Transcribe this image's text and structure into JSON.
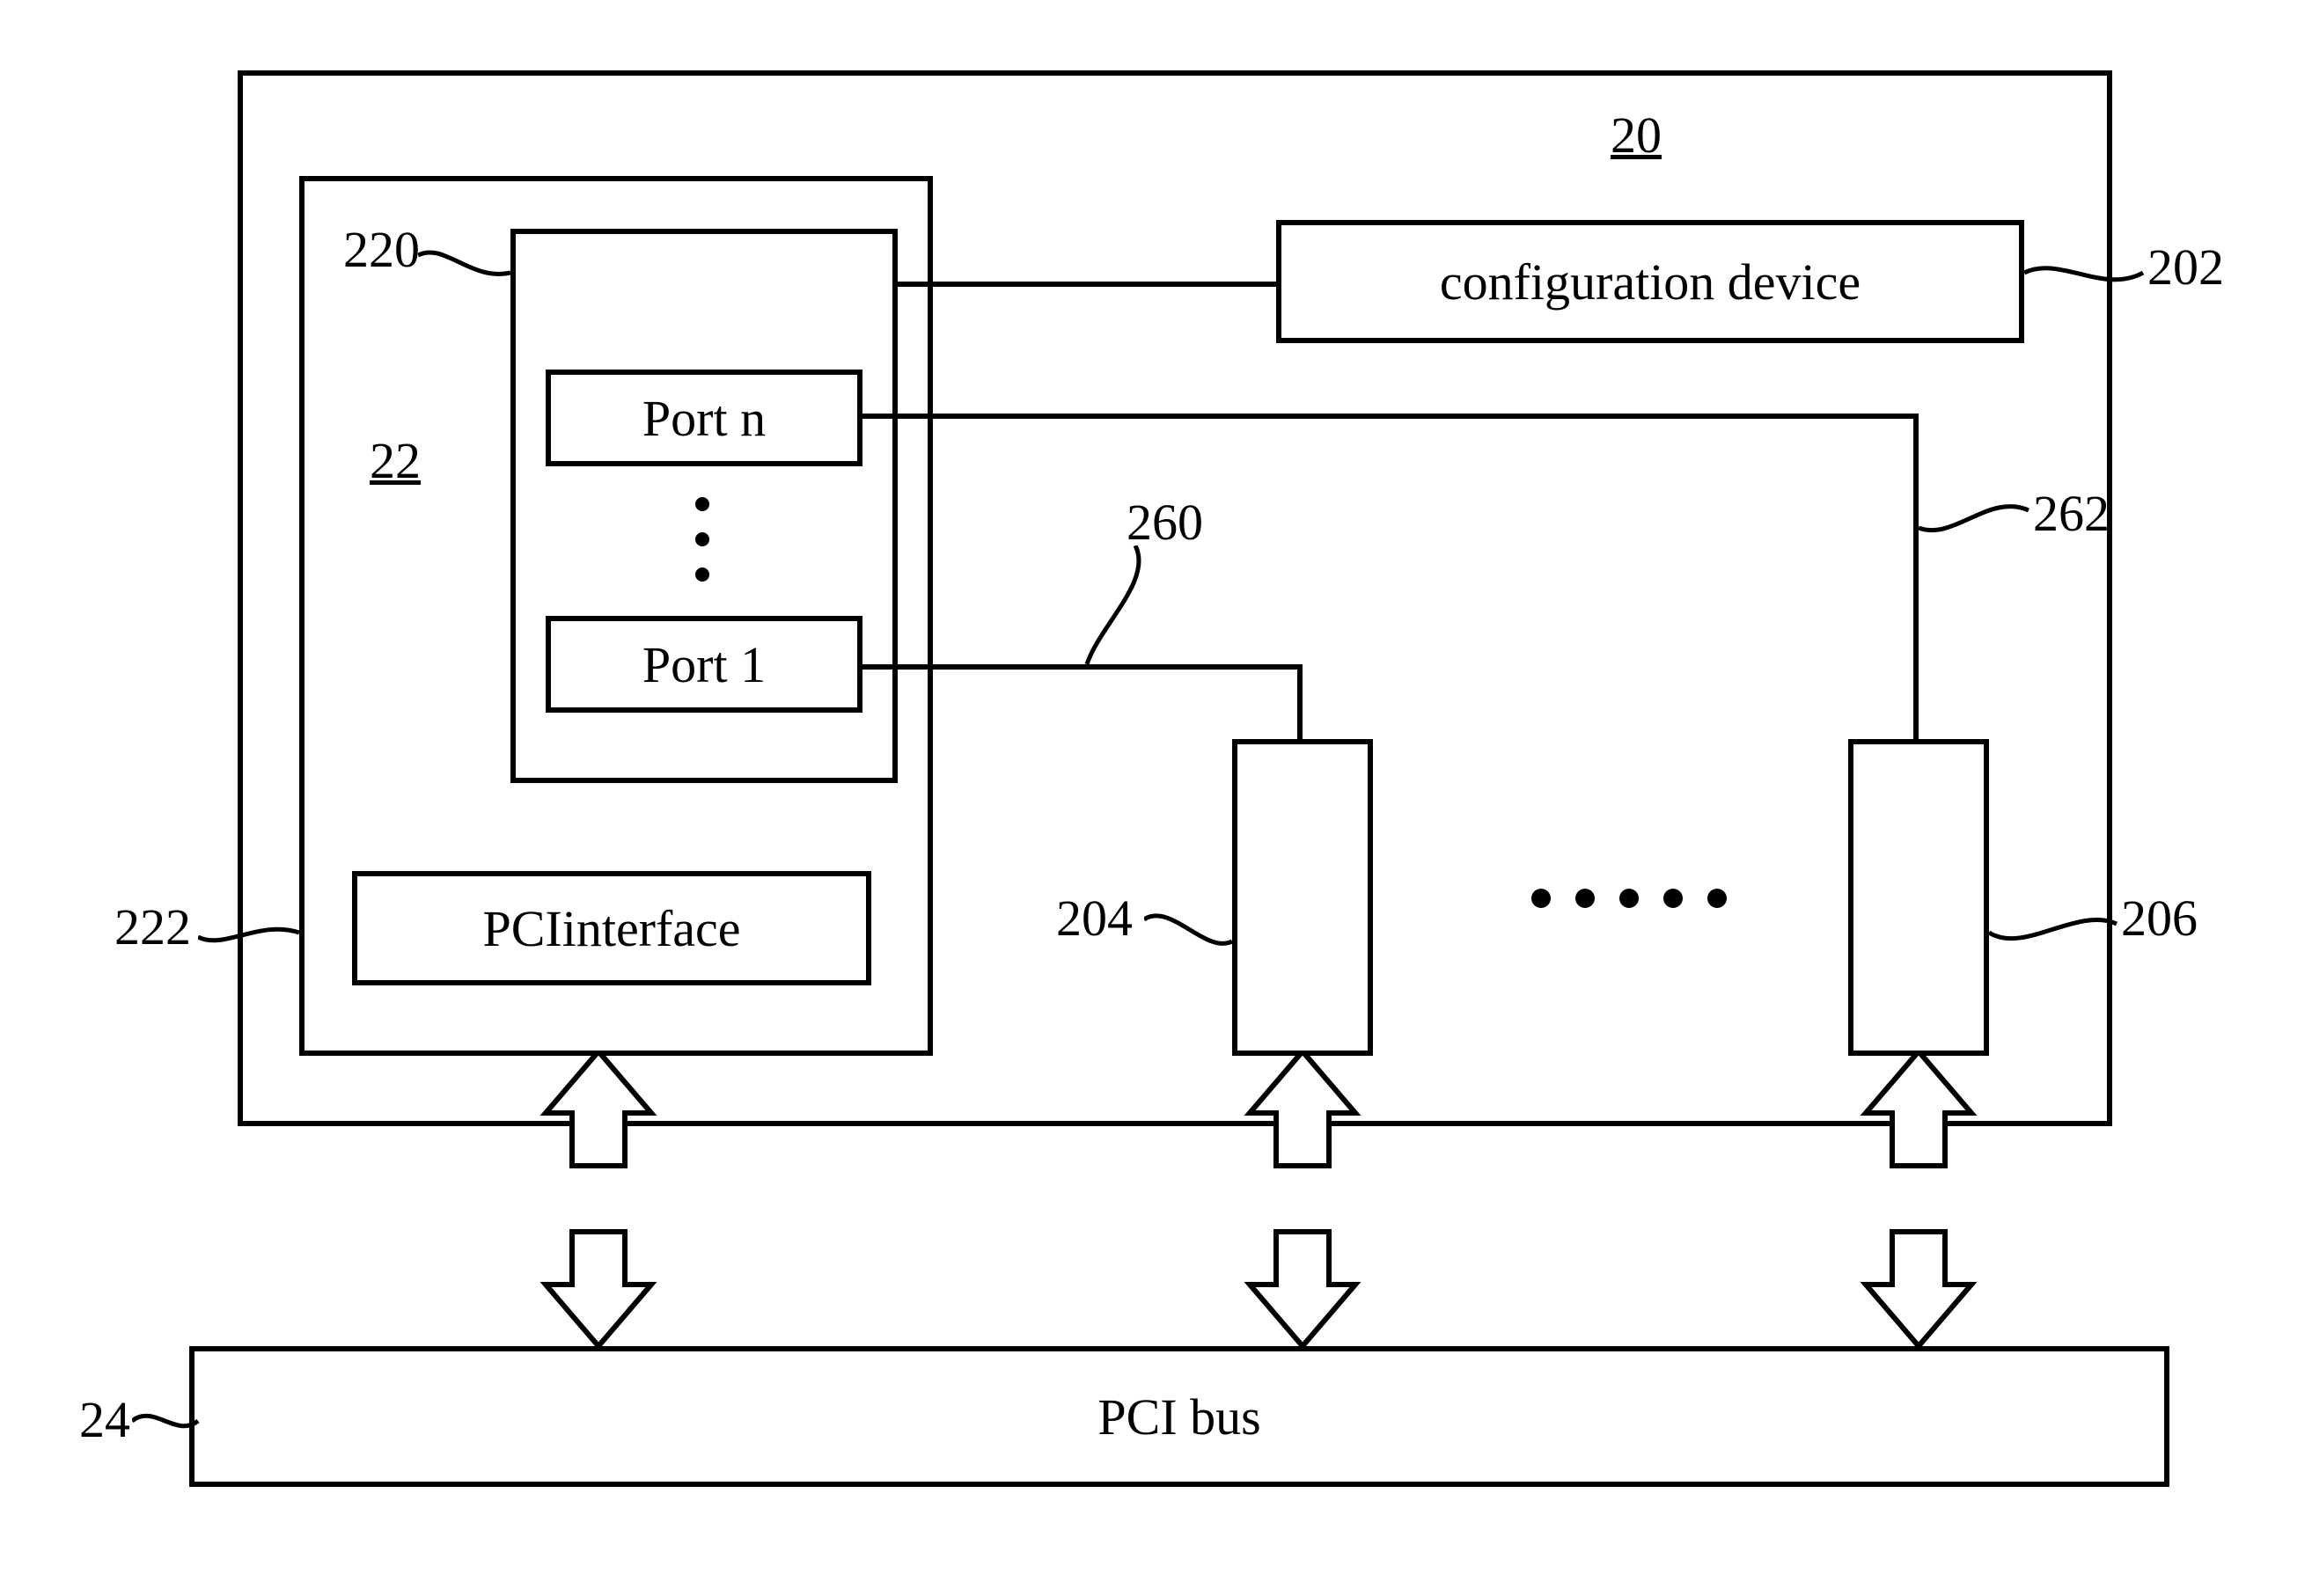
{
  "labels": {
    "ref20": "20",
    "ref22": "22",
    "ref220": "220",
    "ref222": "222",
    "ref202": "202",
    "ref260": "260",
    "ref262": "262",
    "ref204": "204",
    "ref206": "206",
    "ref24": "24",
    "config": "configuration device",
    "portn": "Port n",
    "port1": "Port 1",
    "pciif": "PCIinterface",
    "pcibus": "PCI bus"
  }
}
